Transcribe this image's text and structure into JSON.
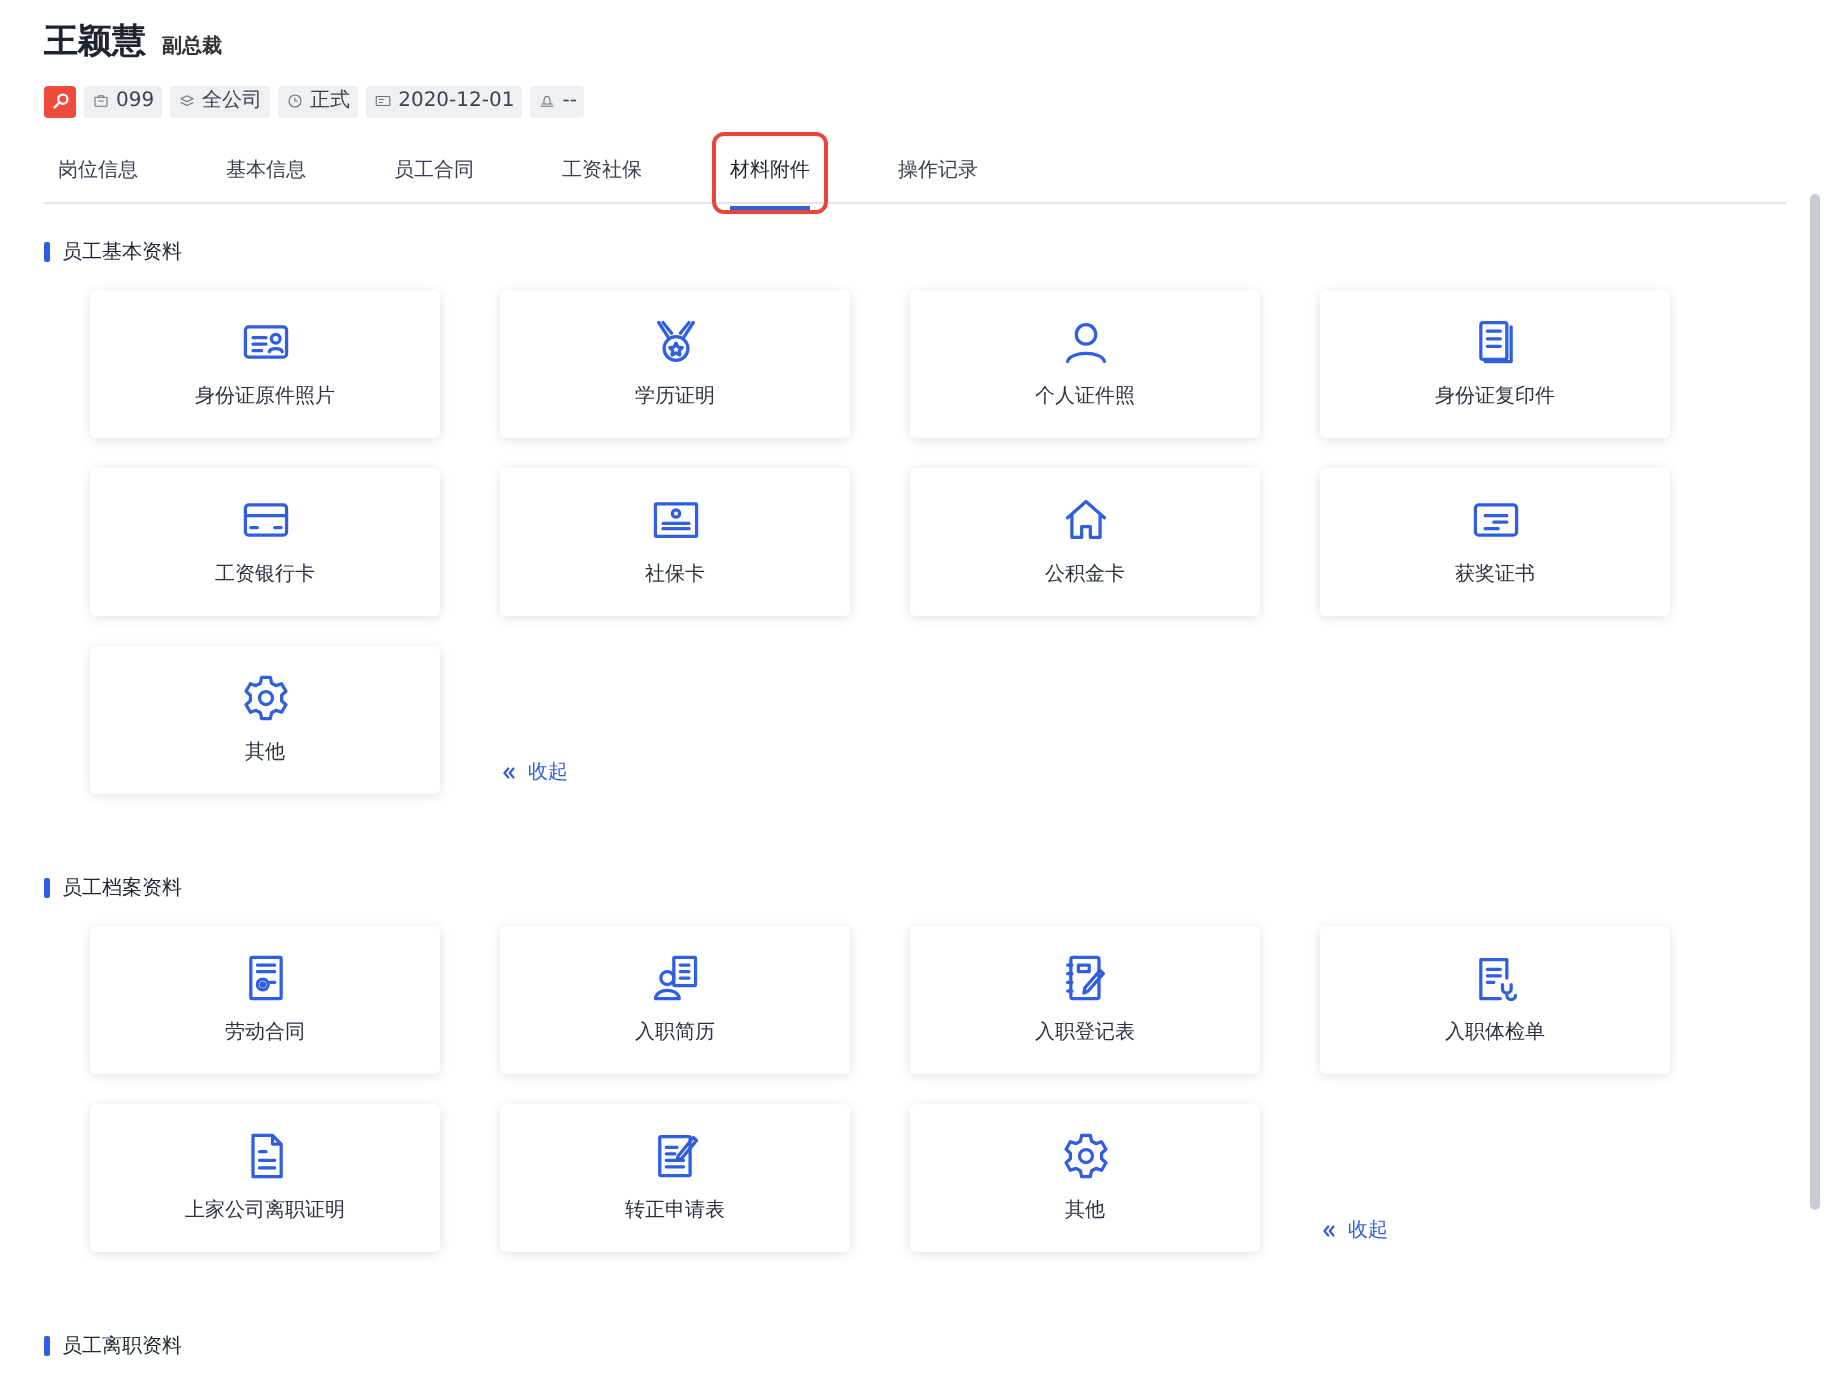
{
  "employee": {
    "name": "王颖慧",
    "position": "副总裁"
  },
  "tags": [
    {
      "kind": "badge"
    },
    {
      "kind": "tag",
      "text": "099"
    },
    {
      "kind": "tag",
      "text": "全公司"
    },
    {
      "kind": "tag",
      "text": "正式"
    },
    {
      "kind": "tag",
      "text": "2020-12-01"
    },
    {
      "kind": "tag",
      "text": "--"
    }
  ],
  "tabs": [
    {
      "label": "岗位信息",
      "selected": false,
      "highlighted": false
    },
    {
      "label": "基本信息",
      "selected": false,
      "highlighted": false
    },
    {
      "label": "员工合同",
      "selected": false,
      "highlighted": false
    },
    {
      "label": "工资社保",
      "selected": false,
      "highlighted": false
    },
    {
      "label": "材料附件",
      "selected": true,
      "highlighted": true
    },
    {
      "label": "操作记录",
      "selected": false,
      "highlighted": false
    }
  ],
  "sections": [
    {
      "title": "员工基本资料",
      "items": [
        "身份证原件照片",
        "学历证明",
        "个人证件照",
        "身份证复印件",
        "工资银行卡",
        "社保卡",
        "公积金卡",
        "获奖证书",
        "其他"
      ],
      "collapse": "收起"
    },
    {
      "title": "员工档案资料",
      "items": [
        "劳动合同",
        "入职简历",
        "入职登记表",
        "入职体检单",
        "上家公司离职证明",
        "转正申请表",
        "其他"
      ],
      "collapse": "收起"
    },
    {
      "title": "员工离职资料"
    }
  ]
}
